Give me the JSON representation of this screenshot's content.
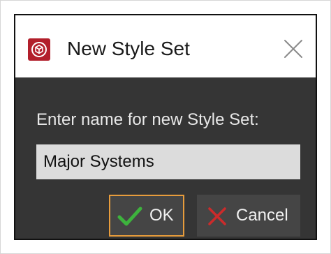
{
  "dialog": {
    "title": "New Style Set",
    "app_icon": "cube-logo-icon",
    "close_icon": "close-icon",
    "prompt": "Enter name for new Style Set:",
    "name_input": {
      "value": "Major Systems"
    },
    "ok_button": {
      "label": "OK",
      "icon": "checkmark-icon"
    },
    "cancel_button": {
      "label": "Cancel",
      "icon": "x-icon"
    }
  },
  "colors": {
    "accent_focus": "#e79c3c",
    "app_icon_bg": "#b21f2b",
    "ok_check": "#3db33d",
    "cancel_x": "#cc2b2b",
    "dialog_body": "#353535"
  }
}
